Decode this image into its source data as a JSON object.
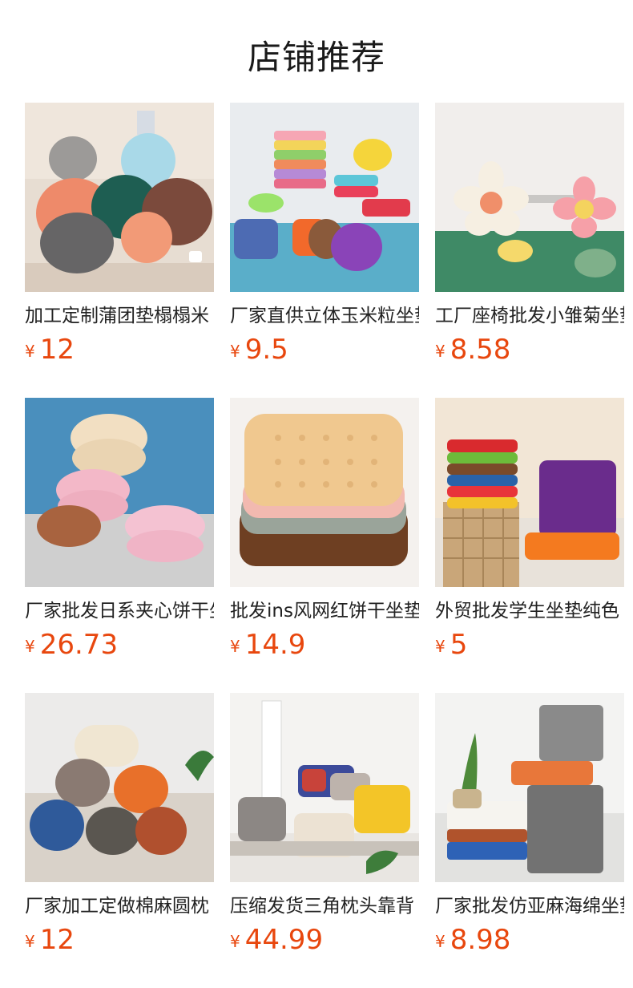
{
  "page": {
    "title": "店铺推荐"
  },
  "products": [
    {
      "name": "加工定制蒲团垫榻榻米",
      "currency": "¥",
      "price": "12",
      "image": "round-cushions-photo"
    },
    {
      "name": "厂家直供立体玉米粒坐垫",
      "currency": "¥",
      "price": "9.5",
      "image": "corn-cushions-photo"
    },
    {
      "name": "工厂座椅批发小雏菊坐垫",
      "currency": "¥",
      "price": "8.58",
      "image": "daisy-cushions-photo"
    },
    {
      "name": "厂家批发日系夹心饼干坐垫",
      "currency": "¥",
      "price": "26.73",
      "image": "sandwich-biscuit-cushions-photo"
    },
    {
      "name": "批发ins风网红饼干坐垫",
      "currency": "¥",
      "price": "14.9",
      "image": "biscuit-cushions-photo"
    },
    {
      "name": "外贸批发学生坐垫纯色",
      "currency": "¥",
      "price": "5",
      "image": "student-cushions-photo"
    },
    {
      "name": "厂家加工定做棉麻圆枕",
      "currency": "¥",
      "price": "12",
      "image": "bolster-pillows-photo"
    },
    {
      "name": "压缩发货三角枕头靠背",
      "currency": "¥",
      "price": "44.99",
      "image": "reading-pillows-photo"
    },
    {
      "name": "厂家批发仿亚麻海绵坐垫",
      "currency": "¥",
      "price": "8.98",
      "image": "linen-sponge-cushions-photo"
    }
  ]
}
